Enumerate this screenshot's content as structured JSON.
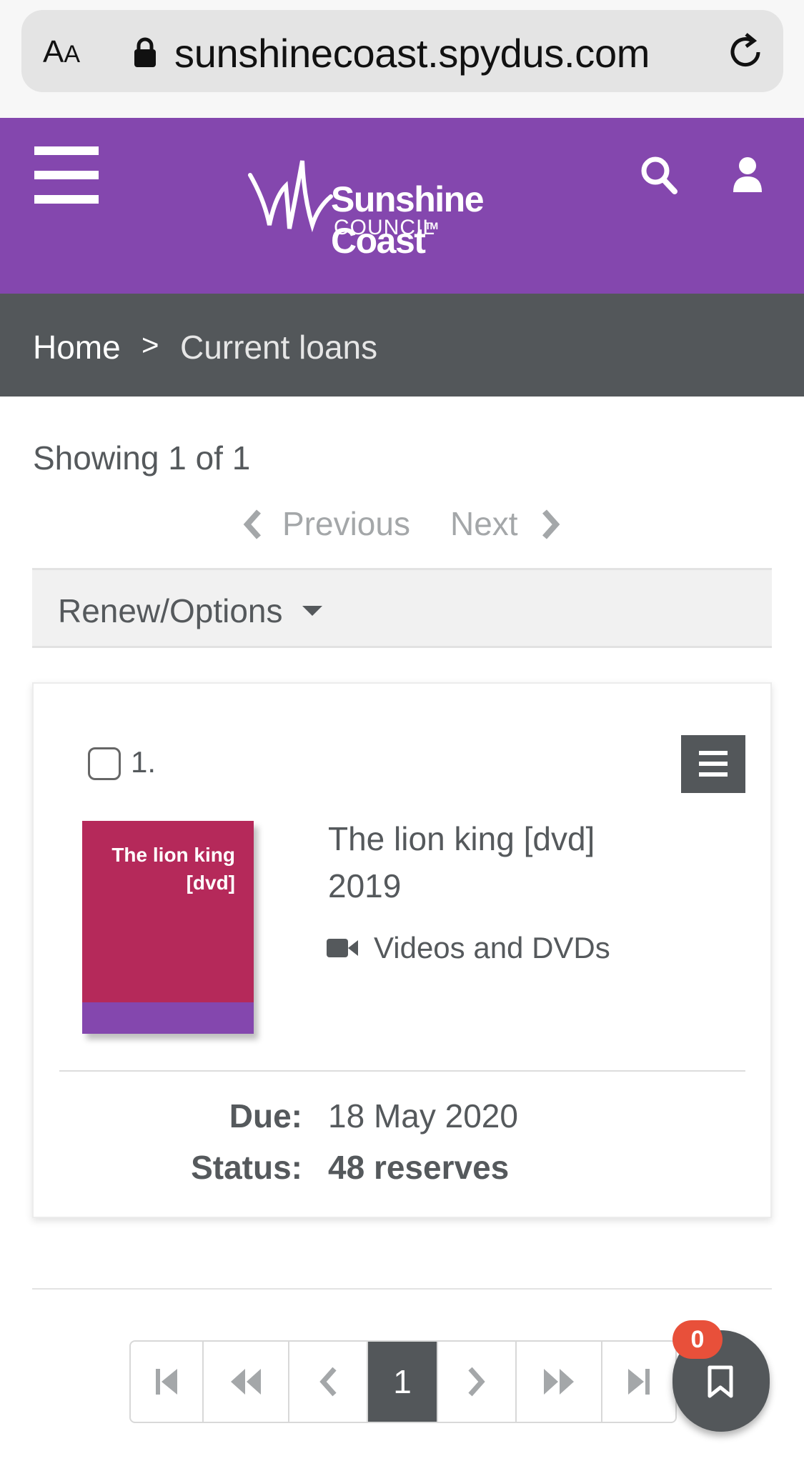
{
  "browser": {
    "text_size_label": "AA",
    "url": "sunshinecoast.spydus.com",
    "lock_icon": "lock-icon",
    "reload_icon": "reload-icon"
  },
  "header": {
    "logo_title": "Sunshine Coast",
    "logo_tm": "TM",
    "logo_sub": "COUNCIL",
    "background": "#8447ae"
  },
  "breadcrumb": {
    "home": "Home",
    "separator": ">",
    "current": "Current loans"
  },
  "results": {
    "showing": "Showing 1 of 1",
    "previous": "Previous",
    "next": "Next"
  },
  "options": {
    "label": "Renew/Options"
  },
  "loans": [
    {
      "number": "1.",
      "cover_text": "The lion king [dvd]",
      "title": "The lion king [dvd]",
      "year": "2019",
      "format": "Videos and DVDs",
      "due_label": "Due:",
      "due_value": "18 May 2020",
      "status_label": "Status:",
      "status_value": "48 reserves"
    }
  ],
  "pagination": {
    "current_page": "1"
  },
  "saved_list": {
    "count": "0"
  },
  "colors": {
    "accent": "#8447ae",
    "dark": "#53575a",
    "cover": "#b5295a",
    "badge": "#e8503a"
  }
}
